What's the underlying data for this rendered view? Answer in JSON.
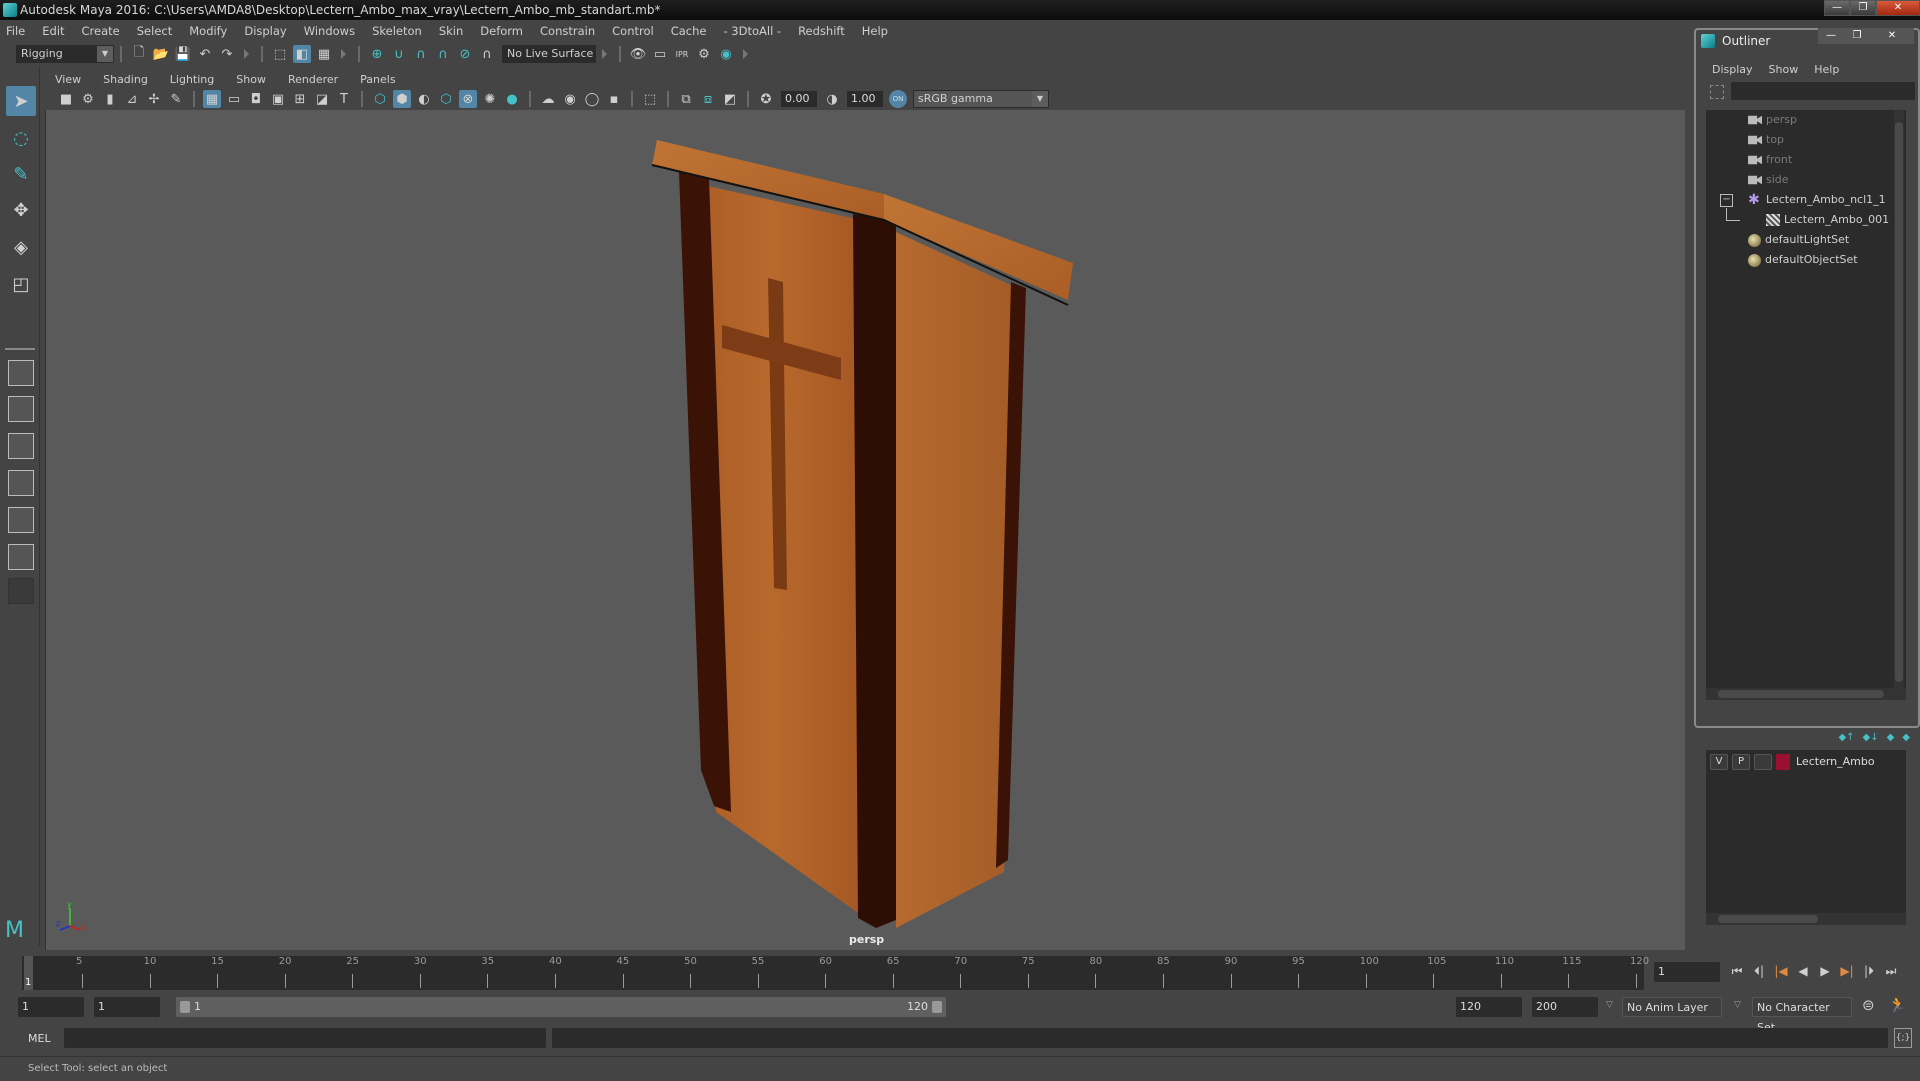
{
  "window": {
    "title": "Autodesk Maya 2016: C:\\Users\\AMDA8\\Desktop\\Lectern_Ambo_max_vray\\Lectern_Ambo_mb_standart.mb*",
    "controls": {
      "minimize": "—",
      "restore": "❐",
      "close": "✕"
    }
  },
  "menubar": {
    "items": [
      "File",
      "Edit",
      "Create",
      "Select",
      "Modify",
      "Display",
      "Windows",
      "Skeleton",
      "Skin",
      "Deform",
      "Constrain",
      "Control",
      "Cache",
      "- 3DtoAll -",
      "Redshift",
      "Help"
    ]
  },
  "statusline": {
    "menuset": "Rigging",
    "live_surface": "No Live Surface",
    "icons": [
      "new-scene-icon",
      "open-scene-icon",
      "save-scene-icon",
      "undo-icon",
      "redo-icon",
      "select-hierarchy-icon",
      "select-object-icon",
      "select-component-icon",
      "snap-grid-icon",
      "snap-curve-icon",
      "snap-point-icon",
      "snap-projected-center-icon",
      "snap-view-plane-icon",
      "make-live-icon",
      "render-view-icon",
      "render-current-icon",
      "ipr-render-icon",
      "render-settings-icon",
      "hypershade-icon"
    ]
  },
  "toolbox": {
    "tools": [
      "select-tool",
      "lasso-tool",
      "paint-select-tool",
      "move-tool",
      "rotate-tool",
      "scale-tool"
    ],
    "active_tool": "select-tool"
  },
  "viewport": {
    "menu": [
      "View",
      "Shading",
      "Lighting",
      "Show",
      "Renderer",
      "Panels"
    ],
    "exposure": "0.00",
    "gamma": "1.00",
    "color_management": "ON",
    "view_transform": "sRGB gamma",
    "camera_label": "persp",
    "axis": {
      "x": "x",
      "y": "y",
      "z": "z"
    }
  },
  "outliner": {
    "title": "Outliner",
    "menu": [
      "Display",
      "Show",
      "Help"
    ],
    "search_value": "",
    "items": [
      {
        "label": "persp",
        "icon": "camera-icon",
        "dim": true
      },
      {
        "label": "top",
        "icon": "camera-icon",
        "dim": true
      },
      {
        "label": "front",
        "icon": "camera-icon",
        "dim": true
      },
      {
        "label": "side",
        "icon": "camera-icon",
        "dim": true
      },
      {
        "label": "Lectern_Ambo_ncl1_1",
        "icon": "transform-icon",
        "expanded": true
      },
      {
        "label": "Lectern_Ambo_001",
        "icon": "mesh-icon",
        "child": true
      },
      {
        "label": "defaultLightSet",
        "icon": "set-icon"
      },
      {
        "label": "defaultObjectSet",
        "icon": "set-icon"
      }
    ]
  },
  "layers": {
    "items": [
      {
        "visible": "V",
        "playback": "P",
        "name": "Lectern_Ambo",
        "color": "#9a1030"
      }
    ]
  },
  "timeline": {
    "ticks": [
      5,
      10,
      15,
      20,
      25,
      30,
      35,
      40,
      45,
      50,
      55,
      60,
      65,
      70,
      75,
      80,
      85,
      90,
      95,
      100,
      105,
      110,
      115,
      120
    ],
    "start": 1,
    "end": 120,
    "current_frame": "1",
    "current_frame_field": "1"
  },
  "range": {
    "start_field": "1",
    "playback_start_field": "1",
    "slider_start": "1",
    "slider_end": "120",
    "playback_end_field": "120",
    "end_field": "200",
    "anim_layer": "No Anim Layer",
    "character_set": "No Character Set"
  },
  "command_line": {
    "language": "MEL",
    "input_value": "",
    "result_value": ""
  },
  "help_line": "Select Tool: select an object"
}
